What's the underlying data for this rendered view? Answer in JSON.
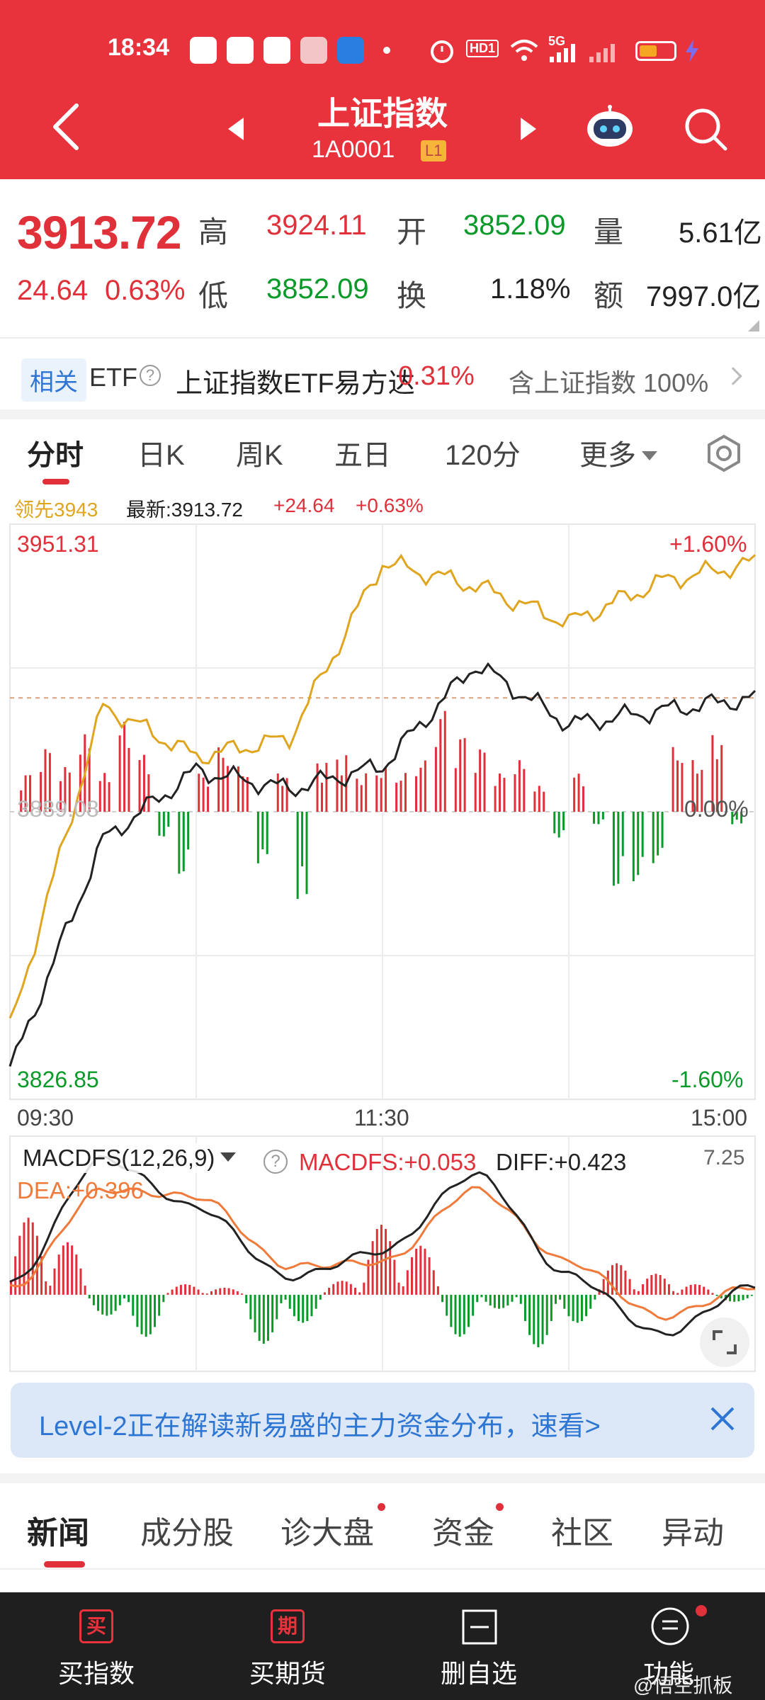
{
  "status_bar": {
    "time": "18:34",
    "app_icons": [
      "toutiao-icon",
      "home-app-icon",
      "bank-app-icon",
      "video-app-icon",
      "alipay-icon"
    ],
    "network": "5G",
    "hd_label": "HD1",
    "battery_color": "#f5a623"
  },
  "header": {
    "title": "上证指数",
    "code": "1A0001",
    "level_badge": "L1",
    "bg_color": "#e8323c"
  },
  "quote": {
    "price": "3913.72",
    "change": "24.64",
    "change_pct": "0.63%",
    "high_label": "高",
    "high": "3924.11",
    "open_label": "开",
    "open": "3852.09",
    "volume_label": "量",
    "volume": "5.61亿",
    "low_label": "低",
    "low": "3852.09",
    "turnover_label": "换",
    "turnover": "1.18%",
    "amount_label": "额",
    "amount": "7997.0亿"
  },
  "related": {
    "tag": "相关",
    "etf_label": "ETF",
    "help_glyph": "?",
    "etf_name": "上证指数ETF易方达",
    "etf_change": "0.31%",
    "contains_label": "含上证指数",
    "contains_pct": "100%"
  },
  "period_tabs": [
    "分时",
    "日K",
    "周K",
    "五日",
    "120分",
    "更多"
  ],
  "chart_legend": {
    "leading": "领先3943",
    "latest": "最新:3913.72",
    "change": "+24.64",
    "change_pct": "+0.63%"
  },
  "chart_labels": {
    "top_price": "3951.31",
    "top_pct": "+1.60%",
    "bottom_price": "3826.85",
    "bottom_pct": "-1.60%",
    "zero_left": "3889.08",
    "zero_right": "0.00%",
    "time_start": "09:30",
    "time_mid": "11:30",
    "time_end": "15:00"
  },
  "chart_data": [
    {
      "type": "line",
      "x": [
        "09:30",
        "10:00",
        "10:30",
        "11:00",
        "11:30",
        "13:30",
        "14:00",
        "14:30",
        "15:00"
      ],
      "series": [
        {
          "name": "最新",
          "color": "#222222",
          "values": [
            3833,
            3883,
            3898,
            3894,
            3899,
            3921,
            3908,
            3911,
            3913.72
          ]
        },
        {
          "name": "领先",
          "color": "#e0a51e",
          "values": [
            3842,
            3912,
            3901,
            3905,
            3943,
            3938,
            3930,
            3939,
            3943
          ]
        }
      ],
      "ylim": [
        3826.85,
        3951.31
      ],
      "volume_bars_pct": {
        "unit": "fraction of half panel",
        "values": [
          0.3,
          0.5,
          0.35,
          0.6,
          0.3,
          0.7,
          0.45,
          -0.2,
          -0.5,
          0.3,
          0.5,
          0.35,
          -0.4,
          0.3,
          -0.7,
          0.4,
          0.45,
          0.3,
          0.35,
          0.3,
          0.4,
          0.8,
          0.6,
          0.5,
          0.3,
          0.4,
          0.2,
          -0.2,
          0.3,
          -0.1,
          -0.6,
          -0.55,
          -0.4,
          0.5,
          0.4,
          0.6,
          -0.1
        ]
      }
    },
    {
      "type": "line",
      "title": "MACDFS(12,26,9)",
      "x": [
        "09:30",
        "10:00",
        "10:30",
        "11:00",
        "11:30",
        "13:30",
        "14:00",
        "14:30",
        "15:00"
      ],
      "series": [
        {
          "name": "DIFF",
          "color": "#222222",
          "values": [
            0.5,
            6.2,
            4.0,
            0.8,
            2.0,
            5.5,
            0.9,
            -1.8,
            0.423
          ]
        },
        {
          "name": "DEA",
          "color": "#f07a3a",
          "values": [
            0.3,
            4.8,
            4.5,
            1.3,
            1.5,
            4.8,
            1.5,
            -1.0,
            0.396
          ]
        }
      ],
      "histogram": [
        2.2,
        1.5,
        -0.6,
        -1.2,
        0.3,
        0.2,
        -1.4,
        -0.8,
        0.4,
        2.0,
        1.4,
        -1.2,
        -0.4,
        -1.5,
        -0.8,
        0.9,
        0.6,
        0.3,
        -0.2
      ],
      "ylim": [
        -3.5,
        7.25
      ]
    }
  ],
  "macd": {
    "title": "MACDFS(12,26,9)",
    "macdfs": "MACDFS:+0.053",
    "diff": "DIFF:+0.423",
    "dea": "DEA:+0.396",
    "scale_max": "7.25",
    "help_glyph": "?"
  },
  "banner": {
    "text": "Level-2正在解读新易盛的主力资金分布，速看>"
  },
  "info_tabs": [
    "新闻",
    "成分股",
    "诊大盘",
    "资金",
    "社区",
    "异动"
  ],
  "bottom_bar": [
    {
      "icon": "买",
      "label": "买指数"
    },
    {
      "icon": "期",
      "label": "买期货"
    },
    {
      "label": "删自选"
    },
    {
      "label": "功能"
    }
  ],
  "watermark": "@悟空抓板",
  "colors": {
    "up": "#e0303a",
    "down": "#0a9a2a",
    "lead": "#e0a51e",
    "dea": "#f07a3a"
  }
}
